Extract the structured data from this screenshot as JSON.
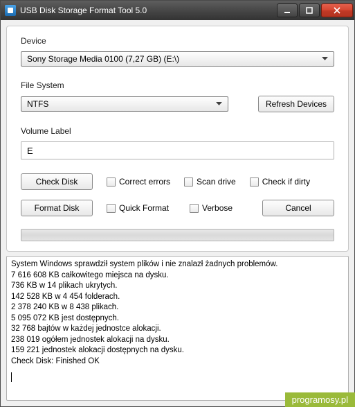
{
  "window": {
    "title": "USB Disk Storage Format Tool 5.0"
  },
  "device": {
    "label": "Device",
    "selected": "Sony  Storage Media  0100 (7,27 GB) (E:\\)"
  },
  "filesystem": {
    "label": "File System",
    "selected": "NTFS",
    "refresh_btn": "Refresh Devices"
  },
  "volume": {
    "label": "Volume Label",
    "value": "E"
  },
  "checkdisk_row": {
    "btn": "Check Disk",
    "correct_errors": "Correct errors",
    "scan_drive": "Scan drive",
    "check_if_dirty": "Check if dirty"
  },
  "format_row": {
    "btn": "Format Disk",
    "quick_format": "Quick Format",
    "verbose": "Verbose",
    "cancel": "Cancel"
  },
  "log_lines": [
    "System Windows sprawdził system plików i nie znalazł żadnych problemów.",
    "7 616 608 KB całkowitego miejsca na dysku.",
    "736 KB w 14 plikach ukrytych.",
    "142 528 KB w 4 454 folderach.",
    "2 378 240 KB w 8 438 plikach.",
    "5 095 072 KB jest dostępnych.",
    "32 768 bajtów w każdej jednostce alokacji.",
    "238 019 ogółem jednostek alokacji na dysku.",
    "159 221 jednostek alokacji dostępnych na dysku.",
    "Check Disk: Finished OK"
  ],
  "watermark": "programosy.pl"
}
